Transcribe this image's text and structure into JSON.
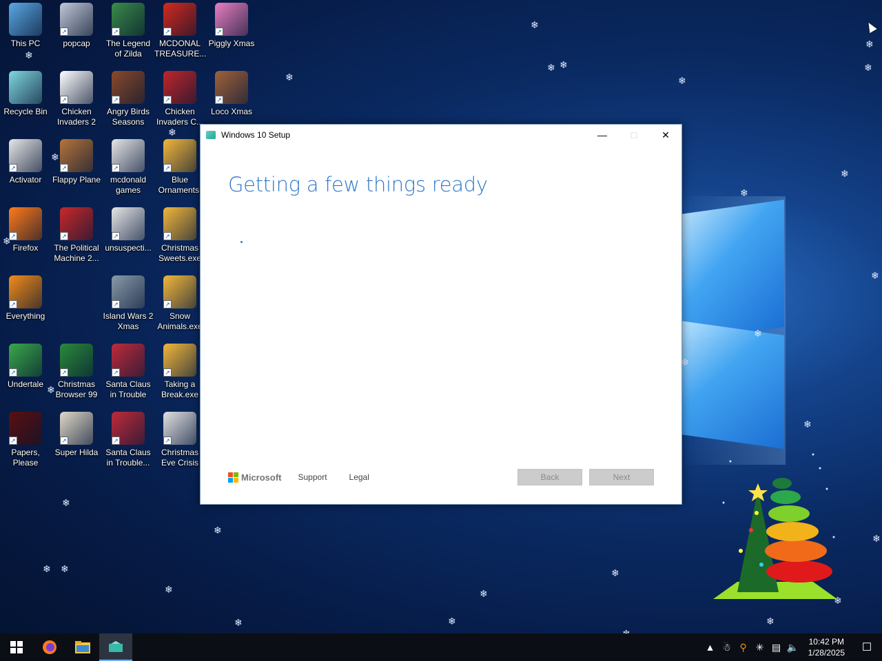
{
  "desktop": {
    "icons": [
      {
        "label": "This PC",
        "icon": "computer-icon",
        "color": "#5aa8e6"
      },
      {
        "label": "popcap",
        "icon": "folder-file-icon",
        "color": "#c0c8d8"
      },
      {
        "label": "The Legend of Zilda",
        "icon": "game-character-icon",
        "color": "#3a8c4a"
      },
      {
        "label": "MCDONAL TREASURE...",
        "icon": "mcdonalds-logo-icon",
        "color": "#d32a1e"
      },
      {
        "label": "Piggly Xmas",
        "icon": "pig-icon",
        "color": "#e87fc0"
      },
      {
        "label": "Recycle Bin",
        "icon": "recycle-bin-icon",
        "color": "#7fd6e0"
      },
      {
        "label": "Chicken Invaders 2",
        "icon": "chicken-icon",
        "color": "#ffffff"
      },
      {
        "label": "Angry Birds Seasons",
        "icon": "angry-birds-icon",
        "color": "#8a4a2a"
      },
      {
        "label": "Chicken Invaders C...",
        "icon": "chicken-snowman-icon",
        "color": "#c0262a"
      },
      {
        "label": "Loco Xmas",
        "icon": "teddy-bear-icon",
        "color": "#a0623a"
      },
      {
        "label": "Activator",
        "icon": "file-icon",
        "color": "#e6e6e6"
      },
      {
        "label": "Flappy Plane",
        "icon": "plane-icon",
        "color": "#b5743a"
      },
      {
        "label": "mcdonald games",
        "icon": "file-icon",
        "color": "#e6e6e6"
      },
      {
        "label": "Blue Ornaments.",
        "icon": "star-shortcut-icon",
        "color": "#f2b73a"
      },
      {
        "label": "Firefox",
        "icon": "firefox-icon",
        "color": "#ff7b1a"
      },
      {
        "label": "The Political Machine 2...",
        "icon": "political-machine-icon",
        "color": "#c8282a"
      },
      {
        "label": "unsuspecti...",
        "icon": "file-icon",
        "color": "#e6e6e6"
      },
      {
        "label": "Christmas Sweets.exe",
        "icon": "star-shortcut-icon",
        "color": "#f2b73a"
      },
      {
        "label": "Everything",
        "icon": "magnifier-icon",
        "color": "#f28c1a"
      },
      {
        "label": "Island Wars 2 Xmas",
        "icon": "island-icon",
        "color": "#8a9aa8"
      },
      {
        "label": "Snow Animals.exe",
        "icon": "star-shortcut-icon",
        "color": "#f2b73a"
      },
      {
        "label": "Undertale",
        "icon": "undertale-icon",
        "color": "#3aa84a"
      },
      {
        "label": "Christmas Browser 99",
        "icon": "christmas-tree-icon",
        "color": "#2a8a3a"
      },
      {
        "label": "Santa Claus in Trouble",
        "icon": "santa-icon",
        "color": "#c02a3a"
      },
      {
        "label": "Taking a Break.exe",
        "icon": "star-shortcut-icon",
        "color": "#f2b73a"
      },
      {
        "label": "Papers, Please",
        "icon": "papers-please-icon",
        "color": "#5a1010"
      },
      {
        "label": "Super Hilda",
        "icon": "pixel-character-icon",
        "color": "#e0d8c8"
      },
      {
        "label": "Santa Claus in Trouble...",
        "icon": "santa-icon",
        "color": "#c02a3a"
      },
      {
        "label": "Christmas Eve Crisis",
        "icon": "santa-face-icon",
        "color": "#e0e0e0"
      }
    ]
  },
  "setup_window": {
    "title": "Windows 10 Setup",
    "heading": "Getting a few things ready",
    "footer": {
      "brand": "Microsoft",
      "support_label": "Support",
      "legal_label": "Legal",
      "back_label": "Back",
      "next_label": "Next"
    }
  },
  "taskbar": {
    "apps": [
      {
        "name": "start",
        "icon": "windows-start-icon"
      },
      {
        "name": "firefox",
        "icon": "firefox-icon"
      },
      {
        "name": "file-explorer",
        "icon": "folder-icon"
      },
      {
        "name": "windows-setup",
        "icon": "setup-icon"
      }
    ],
    "clock": {
      "time": "10:42 PM",
      "date": "1/28/2025"
    }
  },
  "colors": {
    "heading_blue": "#2f78c8",
    "taskbar_bg": "#0b0e14",
    "ms_red": "#f25022",
    "ms_green": "#7fba00",
    "ms_blue": "#00a4ef",
    "ms_yellow": "#ffb900"
  }
}
